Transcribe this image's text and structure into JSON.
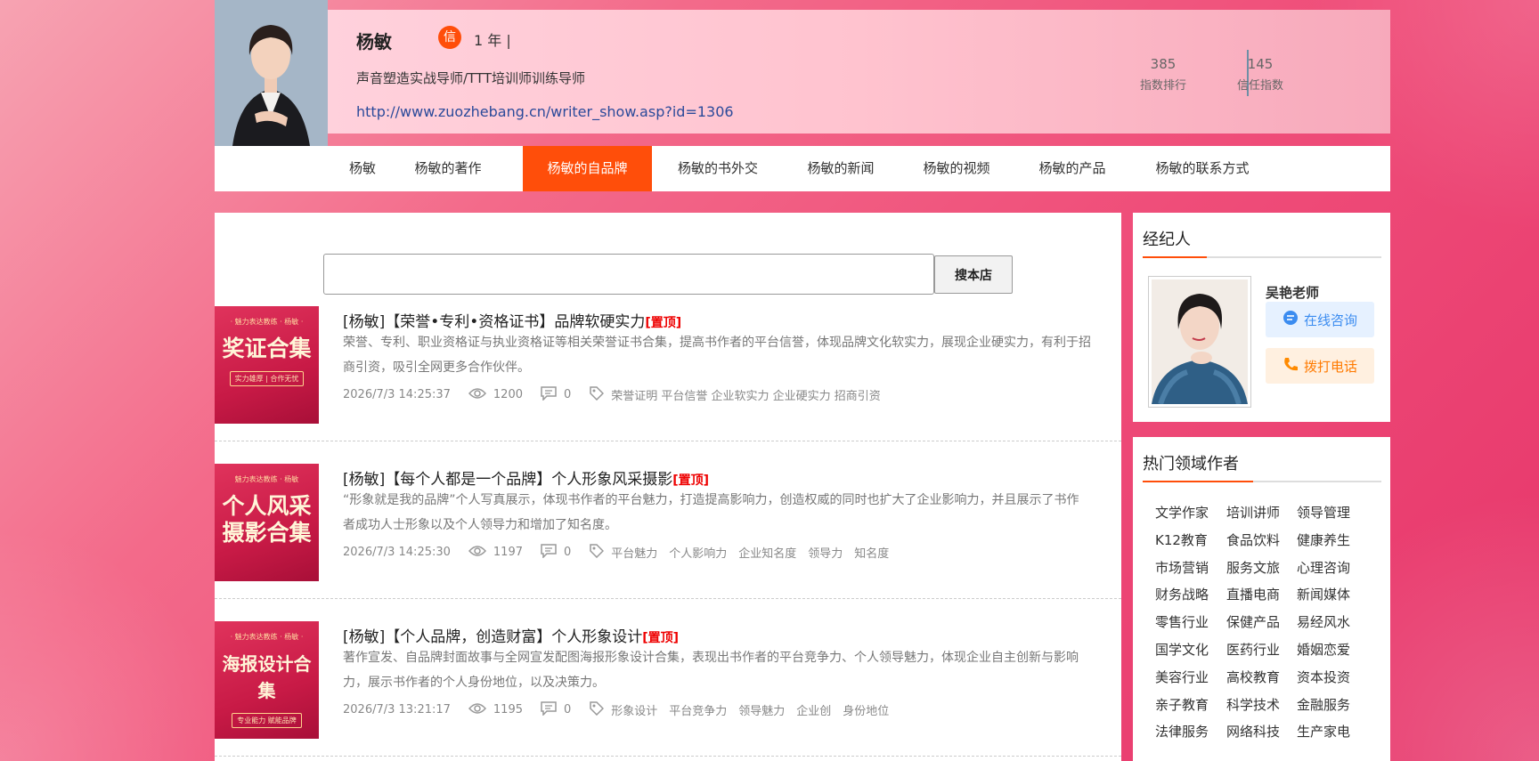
{
  "profile": {
    "name": "杨敏",
    "badge": "信",
    "years": "1 年 |",
    "title": "声音塑造实战导师/TTT培训师训练导师",
    "url": "http://www.zuozhebang.cn/writer_show.asp?id=1306",
    "stats": [
      {
        "num": "385",
        "label": "指数排行"
      },
      {
        "num": "145",
        "label": "信任指数"
      }
    ]
  },
  "nav": {
    "items": [
      {
        "label": "杨敏"
      },
      {
        "label": "杨敏的著作"
      },
      {
        "label": "杨敏的自品牌",
        "active": true
      },
      {
        "label": "杨敏的书外交"
      },
      {
        "label": "杨敏的新闻"
      },
      {
        "label": "杨敏的视频"
      },
      {
        "label": "杨敏的产品"
      },
      {
        "label": "杨敏的联系方式"
      }
    ]
  },
  "search": {
    "value": "",
    "button": "搜本店"
  },
  "articles": [
    {
      "thumb_top": "· 魅力表达教练 · 杨敏 ·",
      "thumb_main": "奖证合集",
      "thumb_sub": "实力雄厚 | 合作无忧",
      "title": "[杨敏]【荣誉•专利•资格证书】品牌软硬实力",
      "top_label": "[置顶]",
      "desc": "荣誉、专利、职业资格证与执业资格证等相关荣誉证书合集，提高书作者的平台信誉，体现品牌文化软实力，展现企业硬实力，有利于招商引资，吸引全网更多合作伙伴。",
      "date": "2026/7/3 14:25:37",
      "views": "1200",
      "comments": "0",
      "tags": "荣誉证明 平台信誉 企业软实力 企业硬实力 招商引资"
    },
    {
      "thumb_top": "魅力表达教练 · 杨敏",
      "thumb_main": "个人风采\n摄影合集",
      "thumb_sub": "",
      "title": "[杨敏]【每个人都是一个品牌】个人形象风采摄影",
      "top_label": "[置顶]",
      "desc": "“形象就是我的品牌”个人写真展示，体现书作者的平台魅力，打造提高影响力，创造权威的同时也扩大了企业影响力，并且展示了书作者成功人士形象以及个人领导力和增加了知名度。",
      "date": "2026/7/3 14:25:30",
      "views": "1197",
      "comments": "0",
      "tags": "平台魅力　个人影响力　企业知名度　领导力　知名度"
    },
    {
      "thumb_top": "· 魅力表达教练 · 杨敏 ·",
      "thumb_main": "海报设计合集",
      "thumb_sub": "专业能力 赋能品牌",
      "title": "[杨敏]【个人品牌，创造财富】个人形象设计",
      "top_label": "[置顶]",
      "desc": "著作宣发、自品牌封面故事与全网宣发配图海报形象设计合集，表现出书作者的平台竞争力、个人领导魅力，体现企业自主创新与影响力，展示书作者的个人身份地位，以及决策力。",
      "date": "2026/7/3 13:21:17",
      "views": "1195",
      "comments": "0",
      "tags": "形象设计　平台竞争力　领导魅力　企业创　身份地位"
    }
  ],
  "agent": {
    "section_title": "经纪人",
    "name": "吴艳老师",
    "consult": "在线咨询",
    "call": "拨打电话"
  },
  "hot": {
    "section_title": "热门领域作者",
    "items": [
      "文学作家",
      "培训讲师",
      "领导管理",
      "K12教育",
      "食品饮料",
      "健康养生",
      "市场营销",
      "服务文旅",
      "心理咨询",
      "财务战略",
      "直播电商",
      "新闻媒体",
      "零售行业",
      "保健产品",
      "易经风水",
      "国学文化",
      "医药行业",
      "婚姻恋爱",
      "美容行业",
      "高校教育",
      "资本投资",
      "亲子教育",
      "科学技术",
      "金融服务",
      "法律服务",
      "网络科技",
      "生产家电"
    ]
  },
  "colors": {
    "accent": "#ff4e0a",
    "link": "#2b4a9a",
    "top_label": "#ee0000"
  }
}
